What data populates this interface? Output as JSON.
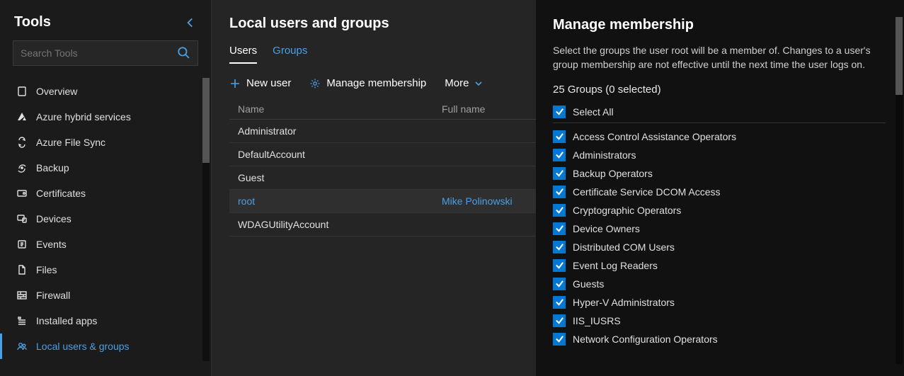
{
  "sidebar": {
    "title": "Tools",
    "search_placeholder": "Search Tools",
    "items": [
      {
        "label": "Overview",
        "icon": "overview"
      },
      {
        "label": "Azure hybrid services",
        "icon": "azure"
      },
      {
        "label": "Azure File Sync",
        "icon": "filesync"
      },
      {
        "label": "Backup",
        "icon": "backup"
      },
      {
        "label": "Certificates",
        "icon": "certificates"
      },
      {
        "label": "Devices",
        "icon": "devices"
      },
      {
        "label": "Events",
        "icon": "events"
      },
      {
        "label": "Files",
        "icon": "files"
      },
      {
        "label": "Firewall",
        "icon": "firewall"
      },
      {
        "label": "Installed apps",
        "icon": "apps"
      },
      {
        "label": "Local users & groups",
        "icon": "usersgroups",
        "active": true
      }
    ]
  },
  "main": {
    "title": "Local users and groups",
    "tabs": [
      {
        "label": "Users",
        "active": true
      },
      {
        "label": "Groups",
        "active": false
      }
    ],
    "toolbar": {
      "new_label": "New user",
      "manage_label": "Manage membership",
      "more_label": "More"
    },
    "columns": {
      "name": "Name",
      "full": "Full name"
    },
    "rows": [
      {
        "name": "Administrator",
        "full": ""
      },
      {
        "name": "DefaultAccount",
        "full": ""
      },
      {
        "name": "Guest",
        "full": ""
      },
      {
        "name": "root",
        "full": "Mike Polinowski",
        "selected": true
      },
      {
        "name": "WDAGUtilityAccount",
        "full": ""
      }
    ]
  },
  "panel": {
    "title": "Manage membership",
    "description": "Select the groups the user root will be a member of. Changes to a user's group membership are not effective until the next time the user logs on.",
    "count_text": "25 Groups (0 selected)",
    "select_all": "Select All",
    "groups": [
      "Access Control Assistance Operators",
      "Administrators",
      "Backup Operators",
      "Certificate Service DCOM Access",
      "Cryptographic Operators",
      "Device Owners",
      "Distributed COM Users",
      "Event Log Readers",
      "Guests",
      "Hyper-V Administrators",
      "IIS_IUSRS",
      "Network Configuration Operators"
    ]
  }
}
